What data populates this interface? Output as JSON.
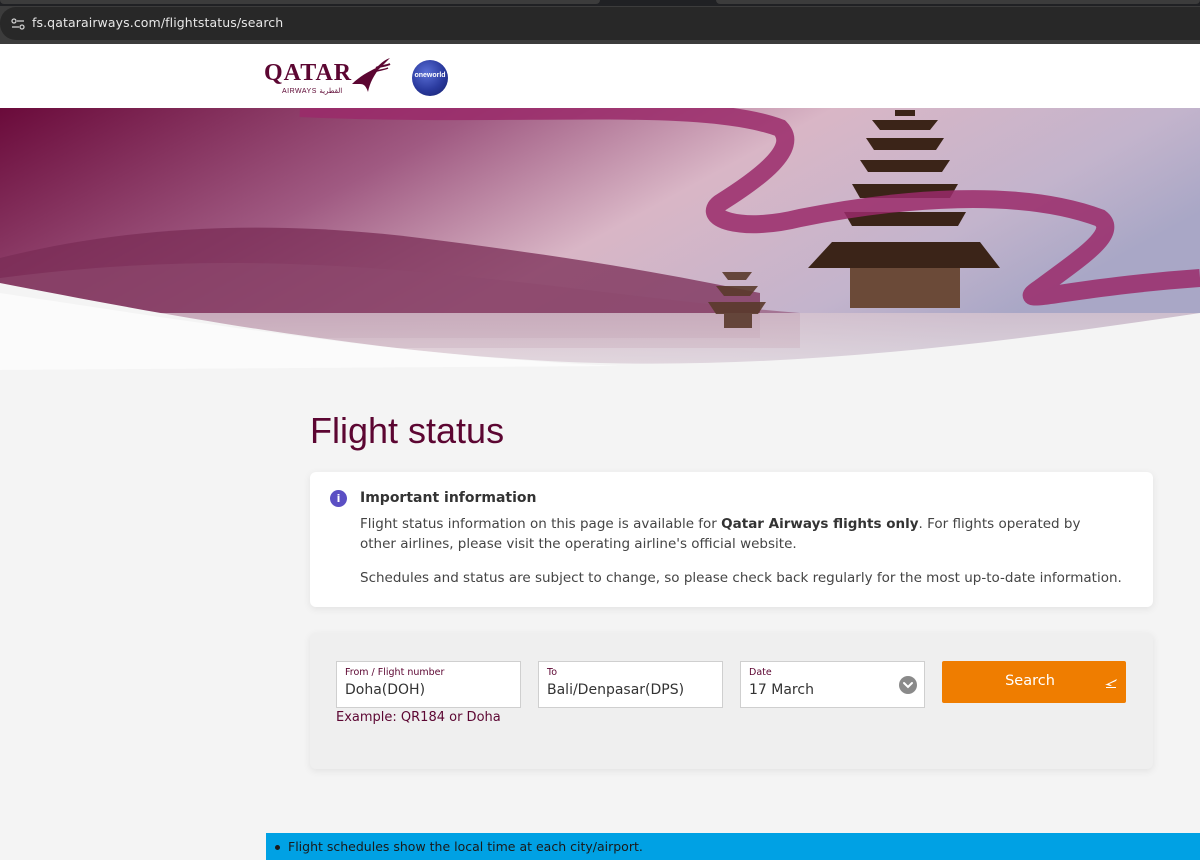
{
  "browser": {
    "url": "fs.qatarairways.com/flightstatus/search"
  },
  "header": {
    "brand_word": "QATAR",
    "brand_sub": "AIRWAYS القطرية",
    "alliance_label": "oneworld"
  },
  "page": {
    "title": "Flight status"
  },
  "info": {
    "icon": "i",
    "title": "Important information",
    "text_before_bold": "Flight status information on this page is available for ",
    "text_bold": "Qatar Airways flights only",
    "text_after_bold": ". For flights operated by other airlines, please visit the operating airline's official website.",
    "text_second": "Schedules and status are subject to change, so please check back regularly for the most up-to-date information."
  },
  "search": {
    "from_label": "From / Flight number",
    "from_value": "Doha(DOH)",
    "to_label": "To",
    "to_value": "Bali/Denpasar(DPS)",
    "date_label": "Date",
    "date_value": "17 March",
    "example": "Example: QR184 or Doha",
    "button_label": "Search"
  },
  "notice": {
    "text": "Flight schedules show the local time at each city/airport."
  },
  "colors": {
    "brand_burgundy": "#5c0632",
    "search_orange": "#ef7d00",
    "notice_blue": "#00a1e4",
    "info_purple": "#5b4fc4"
  }
}
